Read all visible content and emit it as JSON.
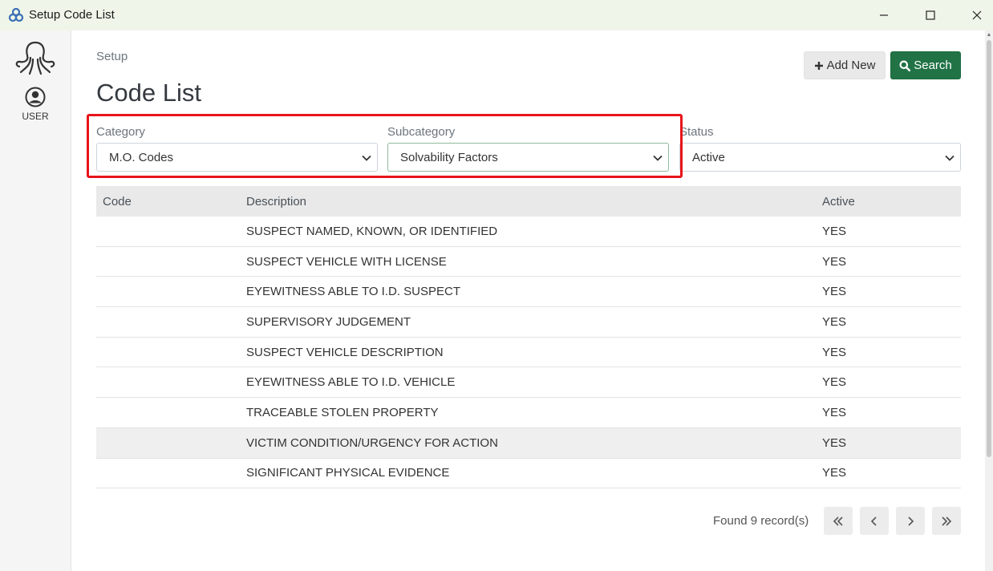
{
  "window": {
    "title": "Setup Code List"
  },
  "sidebar": {
    "user_label": "USER"
  },
  "header": {
    "breadcrumb": "Setup",
    "title": "Code List",
    "add_label": "Add New",
    "search_label": "Search"
  },
  "filters": {
    "category": {
      "label": "Category",
      "value": "M.O. Codes"
    },
    "subcategory": {
      "label": "Subcategory",
      "value": "Solvability Factors"
    },
    "status": {
      "label": "Status",
      "value": "Active"
    }
  },
  "table": {
    "headers": {
      "code": "Code",
      "description": "Description",
      "active": "Active"
    },
    "rows": [
      {
        "code": "",
        "description": "SUSPECT NAMED, KNOWN, OR IDENTIFIED",
        "active": "YES"
      },
      {
        "code": "",
        "description": "SUSPECT VEHICLE WITH LICENSE",
        "active": "YES"
      },
      {
        "code": "",
        "description": "EYEWITNESS ABLE TO I.D. SUSPECT",
        "active": "YES"
      },
      {
        "code": "",
        "description": "SUPERVISORY JUDGEMENT",
        "active": "YES"
      },
      {
        "code": "",
        "description": "SUSPECT VEHICLE DESCRIPTION",
        "active": "YES"
      },
      {
        "code": "",
        "description": "EYEWITNESS ABLE TO I.D. VEHICLE",
        "active": "YES"
      },
      {
        "code": "",
        "description": "TRACEABLE STOLEN PROPERTY",
        "active": "YES"
      },
      {
        "code": "",
        "description": "VICTIM CONDITION/URGENCY FOR ACTION",
        "active": "YES"
      },
      {
        "code": "",
        "description": "SIGNIFICANT PHYSICAL EVIDENCE",
        "active": "YES"
      }
    ]
  },
  "pagination": {
    "found_text": "Found 9 record(s)"
  },
  "colors": {
    "accent": "#217346",
    "highlight": "#e8141b",
    "titlebar": "#eff5e8"
  },
  "icons": {
    "app": "app-logo-icon",
    "minimize": "minimize-icon",
    "maximize": "maximize-icon",
    "close": "close-icon",
    "user": "user-circle-icon",
    "plus": "plus-icon",
    "search": "search-icon",
    "chevron": "chevron-down-icon"
  }
}
